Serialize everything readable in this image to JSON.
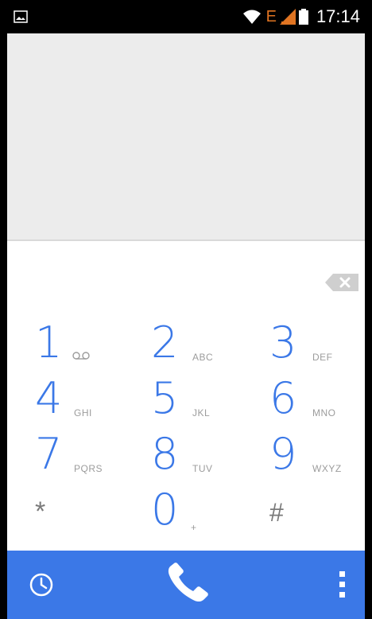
{
  "status_bar": {
    "network_type": "E",
    "time": "17:14",
    "icons": [
      "gallery-icon",
      "wifi-icon",
      "signal-icon",
      "battery-icon"
    ]
  },
  "dialer": {
    "keys": [
      {
        "digit": "1",
        "letters": "",
        "has_voicemail_icon": true
      },
      {
        "digit": "2",
        "letters": "ABC"
      },
      {
        "digit": "3",
        "letters": "DEF"
      },
      {
        "digit": "4",
        "letters": "GHI"
      },
      {
        "digit": "5",
        "letters": "JKL"
      },
      {
        "digit": "6",
        "letters": "MNO"
      },
      {
        "digit": "7",
        "letters": "PQRS"
      },
      {
        "digit": "8",
        "letters": "TUV"
      },
      {
        "digit": "9",
        "letters": "WXYZ"
      },
      {
        "digit": "*",
        "letters": ""
      },
      {
        "digit": "0",
        "letters": "+"
      },
      {
        "digit": "#",
        "letters": ""
      }
    ]
  },
  "bottom_bar": {
    "icons": [
      "history-icon",
      "call-icon",
      "overflow-menu-icon"
    ]
  },
  "colors": {
    "accent": "#3b78e7",
    "status_e": "#e07422",
    "display_bg": "#ececec"
  }
}
